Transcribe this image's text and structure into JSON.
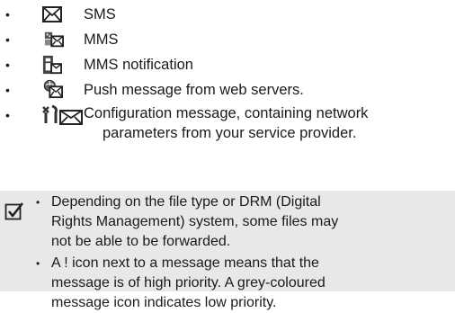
{
  "bullet": "•",
  "items": [
    {
      "label": "SMS",
      "icon": "sms-envelope-icon"
    },
    {
      "label": "MMS",
      "icon": "mms-picture-envelope-icon"
    },
    {
      "label": "MMS notification",
      "icon": "mms-notification-icon"
    },
    {
      "label": "Push message from web servers.",
      "icon": "push-message-icon"
    },
    {
      "label_line1": "Configuration message, containing network",
      "label_line2": "parameters from your service provider.",
      "icon": "configuration-message-icon"
    }
  ],
  "note": {
    "icon": "checkbox-note-icon",
    "points": [
      {
        "lines": [
          "Depending on the file type or DRM (Digital",
          "Rights Management) system, some files may",
          "not be able to be forwarded."
        ]
      },
      {
        "lines": [
          "A ! icon next to a message means that the",
          "message is of high priority. A grey-coloured",
          "message icon indicates low priority."
        ]
      }
    ]
  }
}
